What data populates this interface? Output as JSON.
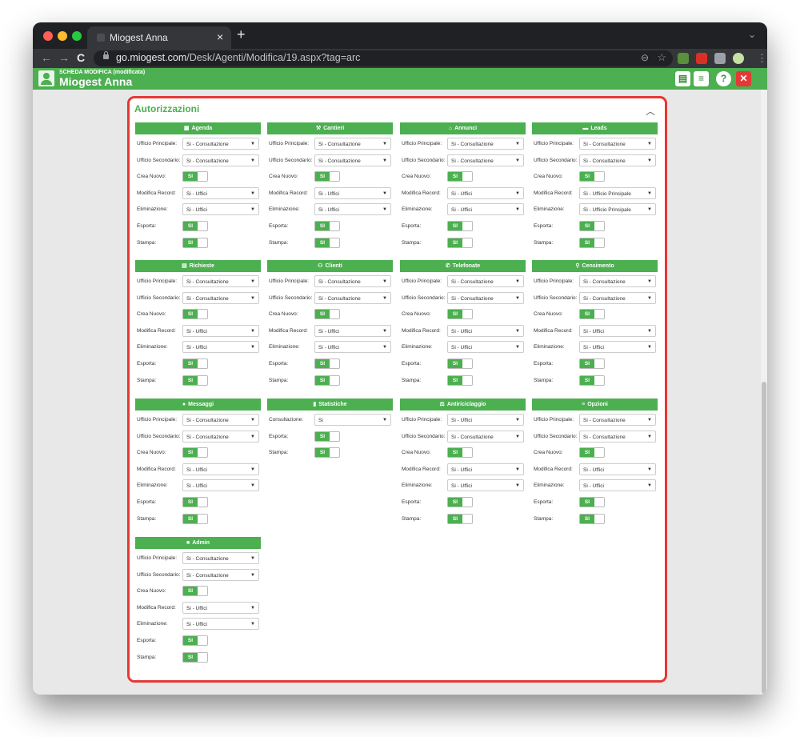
{
  "browser": {
    "tab_title": "Miogest Anna",
    "new_tab": "+",
    "tab_close": "×",
    "url_host": "go.miogest.com",
    "url_path": "/Desk/Agenti/Modifica/19.aspx?tag=arc"
  },
  "app": {
    "subtitle": "SCHEDA MODIFICA (modificata)",
    "title": "Miogest Anna",
    "buttons": [
      {
        "name": "save-button",
        "icon": "floppy-icon",
        "glyph": "▤"
      },
      {
        "name": "menu-button",
        "icon": "hamburger-icon",
        "glyph": "≡"
      },
      {
        "name": "help-button",
        "icon": "question-icon",
        "glyph": "?"
      },
      {
        "name": "close-button",
        "icon": "close-icon",
        "glyph": "✕"
      }
    ]
  },
  "section": {
    "title": "Autorizzazioni",
    "collapse_glyph": "︿"
  },
  "colors": {
    "accent": "#4caf50",
    "border": "#e53935"
  },
  "blocks": [
    {
      "id": "agenda",
      "title": "Agenda",
      "icon": "calendar-icon",
      "glyph": "▦",
      "rows": [
        {
          "label": "Ufficio Principale:",
          "type": "select",
          "value": "Si - Consultazione"
        },
        {
          "label": "Ufficio Secondario:",
          "type": "select",
          "value": "Si - Consultazione"
        },
        {
          "label": "Crea Nuovo:",
          "type": "toggle",
          "value": "SI"
        },
        {
          "label": "Modifica Record:",
          "type": "select",
          "value": "Si - Uffici"
        },
        {
          "label": "Eliminazione:",
          "type": "select",
          "value": "Si - Uffici"
        },
        {
          "label": "Esporta:",
          "type": "toggle",
          "value": "SI"
        },
        {
          "label": "Stampa:",
          "type": "toggle",
          "value": "SI"
        }
      ]
    },
    {
      "id": "cantieri",
      "title": "Cantieri",
      "icon": "worker-icon",
      "glyph": "⚒",
      "rows": [
        {
          "label": "Ufficio Principale:",
          "type": "select",
          "value": "Si - Consultazione"
        },
        {
          "label": "Ufficio Secondario:",
          "type": "select",
          "value": "Si - Consultazione"
        },
        {
          "label": "Crea Nuovo:",
          "type": "toggle",
          "value": "SI"
        },
        {
          "label": "Modifica Record:",
          "type": "select",
          "value": "Si - Uffici"
        },
        {
          "label": "Eliminazione:",
          "type": "select",
          "value": "Si - Uffici"
        },
        {
          "label": "Esporta:",
          "type": "toggle",
          "value": "SI"
        },
        {
          "label": "Stampa:",
          "type": "toggle",
          "value": "SI"
        }
      ]
    },
    {
      "id": "annunci",
      "title": "Annunci",
      "icon": "home-icon",
      "glyph": "⌂",
      "rows": [
        {
          "label": "Ufficio Principale:",
          "type": "select",
          "value": "Si - Consultazione"
        },
        {
          "label": "Ufficio Secondario:",
          "type": "select",
          "value": "Si - Consultazione"
        },
        {
          "label": "Crea Nuovo:",
          "type": "toggle",
          "value": "SI"
        },
        {
          "label": "Modifica Record:",
          "type": "select",
          "value": "Si - Uffici"
        },
        {
          "label": "Eliminazione:",
          "type": "select",
          "value": "Si - Uffici"
        },
        {
          "label": "Esporta:",
          "type": "toggle",
          "value": "SI"
        },
        {
          "label": "Stampa:",
          "type": "toggle",
          "value": "SI"
        }
      ]
    },
    {
      "id": "leads",
      "title": "Leads",
      "icon": "chat-icon",
      "glyph": "▬",
      "rows": [
        {
          "label": "Ufficio Principale:",
          "type": "select",
          "value": "Si - Consultazione"
        },
        {
          "label": "Ufficio Secondario:",
          "type": "select",
          "value": "Si - Consultazione"
        },
        {
          "label": "Crea Nuovo:",
          "type": "toggle",
          "value": "SI"
        },
        {
          "label": "Modifica Record:",
          "type": "select",
          "value": "Si - Ufficio Principale"
        },
        {
          "label": "Eliminazione:",
          "type": "select",
          "value": "Si - Ufficio Principale"
        },
        {
          "label": "Esporta:",
          "type": "toggle",
          "value": "SI"
        },
        {
          "label": "Stampa:",
          "type": "toggle",
          "value": "SI"
        }
      ]
    },
    {
      "id": "richieste",
      "title": "Richieste",
      "icon": "list-icon",
      "glyph": "▤",
      "rows": [
        {
          "label": "Ufficio Principale:",
          "type": "select",
          "value": "Si - Consultazione"
        },
        {
          "label": "Ufficio Secondario:",
          "type": "select",
          "value": "Si - Consultazione"
        },
        {
          "label": "Crea Nuovo:",
          "type": "toggle",
          "value": "SI"
        },
        {
          "label": "Modifica Record:",
          "type": "select",
          "value": "Si - Uffici"
        },
        {
          "label": "Eliminazione:",
          "type": "select",
          "value": "Si - Uffici"
        },
        {
          "label": "Esporta:",
          "type": "toggle",
          "value": "SI"
        },
        {
          "label": "Stampa:",
          "type": "toggle",
          "value": "SI"
        }
      ]
    },
    {
      "id": "clienti",
      "title": "Clienti",
      "icon": "users-icon",
      "glyph": "⚇",
      "rows": [
        {
          "label": "Ufficio Principale:",
          "type": "select",
          "value": "Si - Consultazione"
        },
        {
          "label": "Ufficio Secondario:",
          "type": "select",
          "value": "Si - Consultazione"
        },
        {
          "label": "Crea Nuovo:",
          "type": "toggle",
          "value": "SI"
        },
        {
          "label": "Modifica Record:",
          "type": "select",
          "value": "Si - Uffici"
        },
        {
          "label": "Eliminazione:",
          "type": "select",
          "value": "Si - Uffici"
        },
        {
          "label": "Esporta:",
          "type": "toggle",
          "value": "SI"
        },
        {
          "label": "Stampa:",
          "type": "toggle",
          "value": "SI"
        }
      ]
    },
    {
      "id": "telefonate",
      "title": "Telefonate",
      "icon": "phone-icon",
      "glyph": "✆",
      "rows": [
        {
          "label": "Ufficio Principale:",
          "type": "select",
          "value": "Si - Consultazione"
        },
        {
          "label": "Ufficio Secondario:",
          "type": "select",
          "value": "Si - Consultazione"
        },
        {
          "label": "Crea Nuovo:",
          "type": "toggle",
          "value": "SI"
        },
        {
          "label": "Modifica Record:",
          "type": "select",
          "value": "Si - Uffici"
        },
        {
          "label": "Eliminazione:",
          "type": "select",
          "value": "Si - Uffici"
        },
        {
          "label": "Esporta:",
          "type": "toggle",
          "value": "SI"
        },
        {
          "label": "Stampa:",
          "type": "toggle",
          "value": "SI"
        }
      ]
    },
    {
      "id": "censimento",
      "title": "Censimento",
      "icon": "map-pin-icon",
      "glyph": "⚲",
      "rows": [
        {
          "label": "Ufficio Principale:",
          "type": "select",
          "value": "Si - Consultazione"
        },
        {
          "label": "Ufficio Secondario:",
          "type": "select",
          "value": "Si - Consultazione"
        },
        {
          "label": "Crea Nuovo:",
          "type": "toggle",
          "value": "SI"
        },
        {
          "label": "Modifica Record:",
          "type": "select",
          "value": "Si - Uffici"
        },
        {
          "label": "Eliminazione:",
          "type": "select",
          "value": "Si - Uffici"
        },
        {
          "label": "Esporta:",
          "type": "toggle",
          "value": "SI"
        },
        {
          "label": "Stampa:",
          "type": "toggle",
          "value": "SI"
        }
      ]
    },
    {
      "id": "messaggi",
      "title": "Messaggi",
      "icon": "speech-bubble-icon",
      "glyph": "●",
      "rows": [
        {
          "label": "Ufficio Principale:",
          "type": "select",
          "value": "Si - Consultazione"
        },
        {
          "label": "Ufficio Secondario:",
          "type": "select",
          "value": "Si - Consultazione"
        },
        {
          "label": "Crea Nuovo:",
          "type": "toggle",
          "value": "SI"
        },
        {
          "label": "Modifica Record:",
          "type": "select",
          "value": "Si - Uffici"
        },
        {
          "label": "Eliminazione:",
          "type": "select",
          "value": "Si - Uffici"
        },
        {
          "label": "Esporta:",
          "type": "toggle",
          "value": "SI"
        },
        {
          "label": "Stampa:",
          "type": "toggle",
          "value": "SI"
        }
      ]
    },
    {
      "id": "statistiche",
      "title": "Statistiche",
      "icon": "bar-chart-icon",
      "glyph": "▮",
      "rows": [
        {
          "label": "Consultazione:",
          "type": "select",
          "value": "Si"
        },
        {
          "label": "Esporta:",
          "type": "toggle",
          "value": "SI"
        },
        {
          "label": "Stampa:",
          "type": "toggle",
          "value": "SI"
        }
      ]
    },
    {
      "id": "antiriciclaggio",
      "title": "Antiriciclaggio",
      "icon": "scale-icon",
      "glyph": "⚖",
      "rows": [
        {
          "label": "Ufficio Principale:",
          "type": "select",
          "value": "Si - Uffici"
        },
        {
          "label": "Ufficio Secondario:",
          "type": "select",
          "value": "Si - Consultazione"
        },
        {
          "label": "Crea Nuovo:",
          "type": "toggle",
          "value": "SI"
        },
        {
          "label": "Modifica Record:",
          "type": "select",
          "value": "Si - Uffici"
        },
        {
          "label": "Eliminazione:",
          "type": "select",
          "value": "Si - Uffici"
        },
        {
          "label": "Esporta:",
          "type": "toggle",
          "value": "SI"
        },
        {
          "label": "Stampa:",
          "type": "toggle",
          "value": "SI"
        }
      ]
    },
    {
      "id": "opzioni",
      "title": "Opzioni",
      "icon": "menu-lines-icon",
      "glyph": "≡",
      "rows": [
        {
          "label": "Ufficio Principale:",
          "type": "select",
          "value": "Si - Consultazione"
        },
        {
          "label": "Ufficio Secondario:",
          "type": "select",
          "value": "Si - Consultazione"
        },
        {
          "label": "Crea Nuovo:",
          "type": "toggle",
          "value": "SI"
        },
        {
          "label": "Modifica Record:",
          "type": "select",
          "value": "Si - Uffici"
        },
        {
          "label": "Eliminazione:",
          "type": "select",
          "value": "Si - Uffici"
        },
        {
          "label": "Esporta:",
          "type": "toggle",
          "value": "SI"
        },
        {
          "label": "Stampa:",
          "type": "toggle",
          "value": "SI"
        }
      ]
    },
    {
      "id": "admin",
      "title": "Admin",
      "icon": "lock-icon",
      "glyph": "■",
      "rows": [
        {
          "label": "Ufficio Principale:",
          "type": "select",
          "value": "Si - Consultazione"
        },
        {
          "label": "Ufficio Secondario:",
          "type": "select",
          "value": "Si - Consultazione"
        },
        {
          "label": "Crea Nuovo:",
          "type": "toggle",
          "value": "SI"
        },
        {
          "label": "Modifica Record:",
          "type": "select",
          "value": "Si - Uffici"
        },
        {
          "label": "Eliminazione:",
          "type": "select",
          "value": "Si - Uffici"
        },
        {
          "label": "Esporta:",
          "type": "toggle",
          "value": "SI"
        },
        {
          "label": "Stampa:",
          "type": "toggle",
          "value": "SI"
        }
      ]
    }
  ]
}
